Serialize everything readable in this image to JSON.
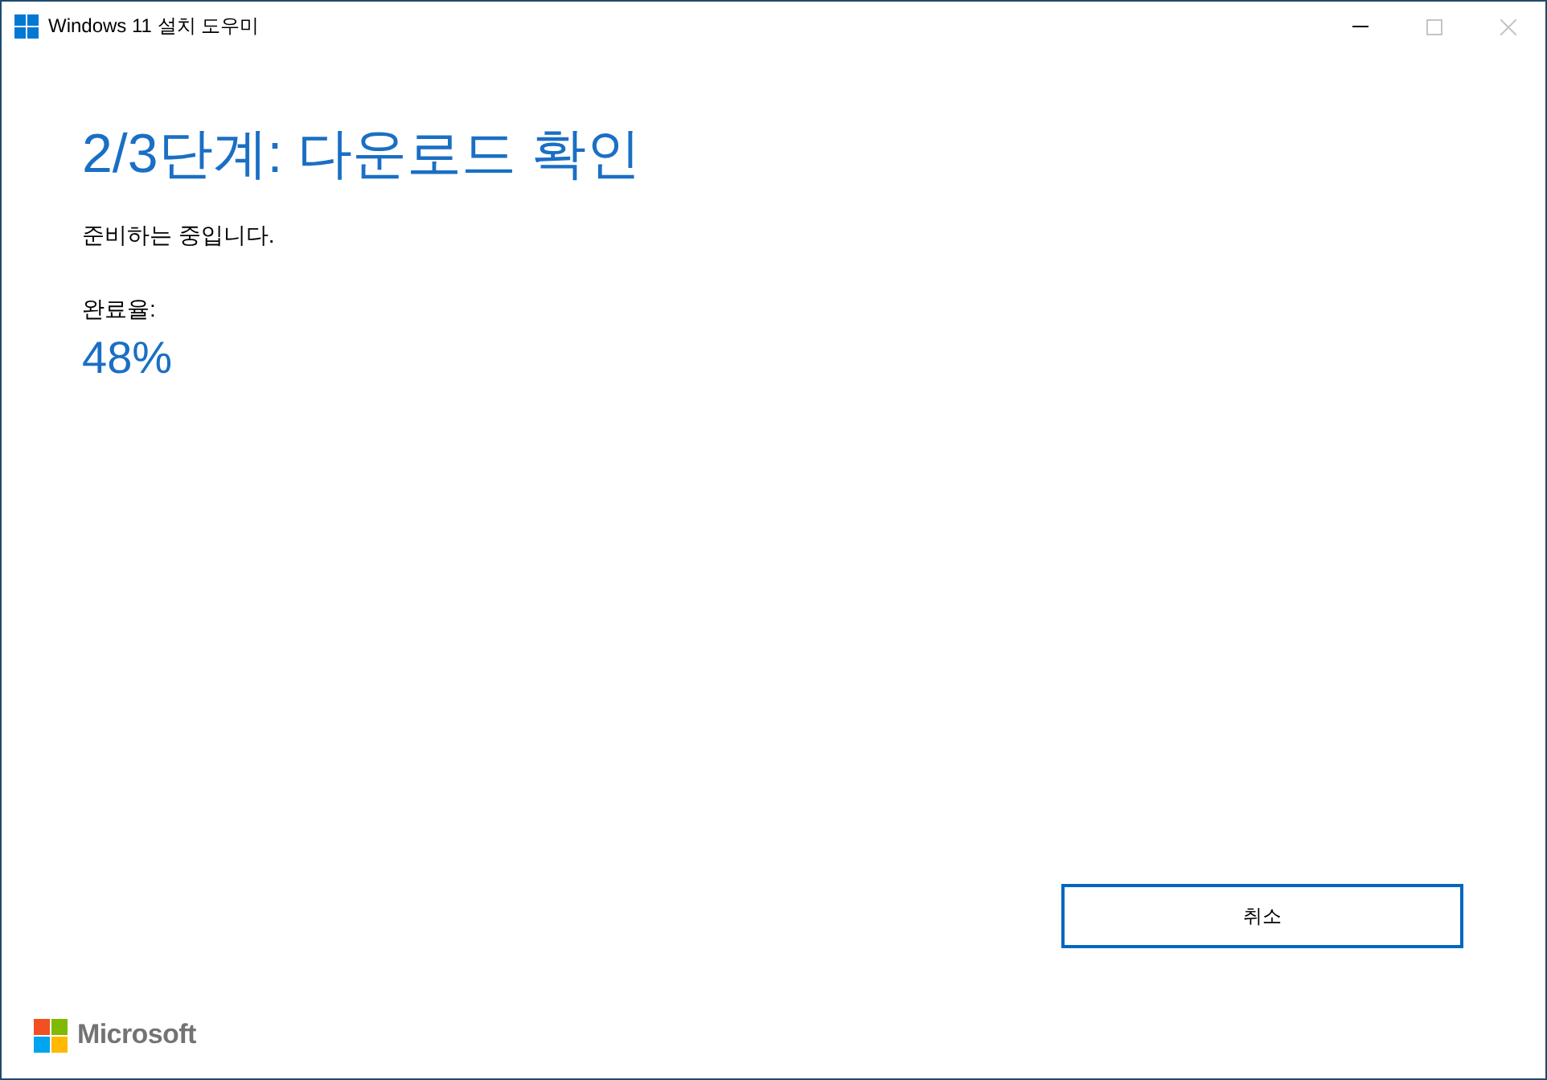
{
  "window": {
    "title": "Windows 11 설치 도우미",
    "controls": [
      {
        "kind": "minimize",
        "disabled": false
      },
      {
        "kind": "maximize",
        "disabled": true
      },
      {
        "kind": "close",
        "disabled": true
      }
    ]
  },
  "heading": "2/3단계: 다운로드 확인",
  "status": "준비하는 중입니다.",
  "progress": {
    "label": "완료율:",
    "percent": "48%"
  },
  "buttons": [
    {
      "label": "취소"
    }
  ],
  "footer": {
    "brand": "Microsoft"
  }
}
